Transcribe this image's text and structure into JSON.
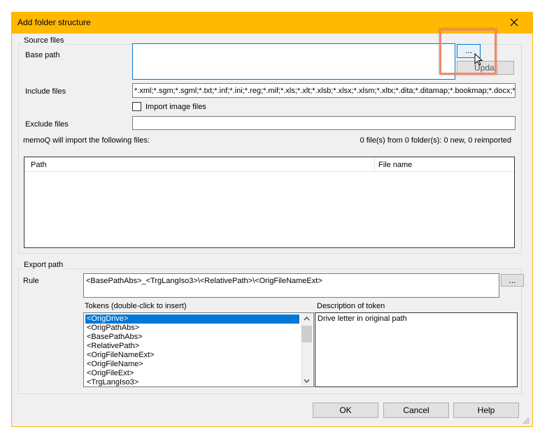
{
  "window": {
    "title": "Add folder structure",
    "close_icon": "close-icon"
  },
  "source": {
    "legend": "Source files",
    "base_path_label": "Base path",
    "base_path_value": "",
    "browse_label": "...",
    "update_label": "Updat",
    "include_label": "Include files",
    "include_value": "*.xml;*.sgm;*.sgml;*.txt;*.inf;*.ini;*.reg;*.mif;*.xls;*.xlt;*.xlsb;*.xlsx;*.xlsm;*.xltx;*.dita;*.ditamap;*.bookmap;*.docx;*.docm",
    "import_images_label": "Import image files",
    "import_images_checked": false,
    "exclude_label": "Exclude files",
    "exclude_value": "",
    "import_info": "memoQ will import the following files:",
    "count_info": "0 file(s) from 0 folder(s): 0 new, 0 reimported",
    "table": {
      "columns": [
        "Path",
        "File name"
      ],
      "rows": []
    }
  },
  "export": {
    "legend": "Export path",
    "rule_label": "Rule",
    "rule_value": "<BasePathAbs>_<TrgLangIso3>\\<RelativePath>\\<OrigFileNameExt>",
    "rule_button": "...",
    "tokens_label": "Tokens (double-click to insert)",
    "tokens": [
      "<OrigDrive>",
      "<OrigPathAbs>",
      "<BasePathAbs>",
      "<RelativePath>",
      "<OrigFileNameExt>",
      "<OrigFileName>",
      "<OrigFileExt>",
      "<TrgLangIso3>"
    ],
    "selected_token": 0,
    "description_label": "Description of token",
    "description_value": "Drive letter in original path"
  },
  "buttons": {
    "ok": "OK",
    "cancel": "Cancel",
    "help": "Help"
  },
  "colors": {
    "title_bar": "#FFB900",
    "selection": "#0078D7",
    "highlight": "#F08A65"
  }
}
